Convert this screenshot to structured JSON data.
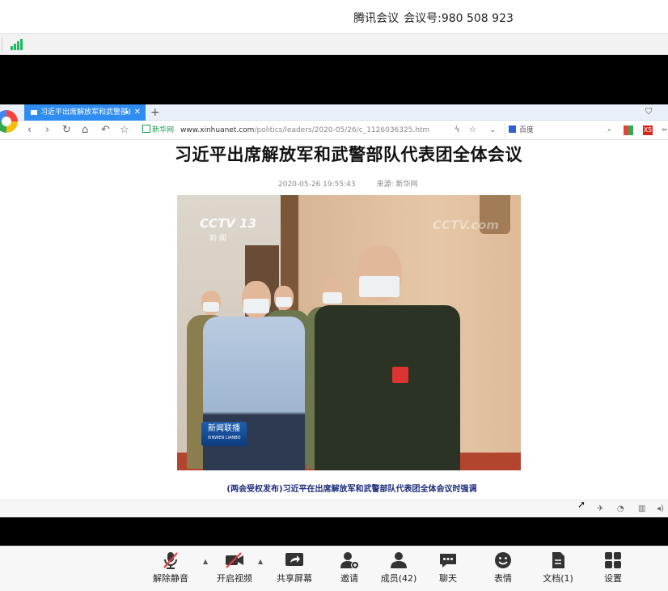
{
  "meeting": {
    "app_name": "腾讯会议",
    "id_label": "会议号:",
    "id_value": "980 508 923"
  },
  "browser": {
    "tab_title": "习近平出席解放军和武警部",
    "address": {
      "site_tag": "新华网",
      "host": "www.xinhuanet.com",
      "path": "/politics/leaders/2020-05/26/c_1126036325.htm"
    },
    "search_engine_label": "百度",
    "icons": [
      "back-icon",
      "forward-icon",
      "refresh-icon",
      "home-icon",
      "undo-icon",
      "star-icon",
      "lightning-icon",
      "bookmark-star-icon",
      "dropdown-icon",
      "search-icon",
      "shirt-icon"
    ]
  },
  "article": {
    "title": "习近平出席解放军和武警部队代表团全体会议",
    "date": "2020-05-26 19:55:43",
    "source_label": "来源:",
    "source_value": "新华网",
    "photo_overlay": {
      "channel_logo": "CCTV 13",
      "channel_sub": "新 闻",
      "watermark": "CCTV.com",
      "badge_main": "新闻联播",
      "badge_sub": "XINWEN LIANBO"
    },
    "caption": "(两会受权发布)习近平在出席解放军和武警部队代表团全体会议时强调"
  },
  "toolbar": {
    "buttons": [
      {
        "label": "解除静音",
        "icon": "microphone-muted-icon"
      },
      {
        "label": "开启视频",
        "icon": "camera-off-icon"
      },
      {
        "label": "共享屏幕",
        "icon": "share-screen-icon"
      },
      {
        "label": "邀请",
        "icon": "invite-user-icon"
      },
      {
        "label": "成员(42)",
        "icon": "members-icon"
      },
      {
        "label": "聊天",
        "icon": "chat-icon"
      },
      {
        "label": "表情",
        "icon": "emoji-icon"
      },
      {
        "label": "文档(1)",
        "icon": "document-icon"
      },
      {
        "label": "设置",
        "icon": "settings-grid-icon"
      }
    ]
  },
  "colors": {
    "signal": "#1dbb5f",
    "tab_active": "#2f8cf0",
    "caption": "#1a2b7a",
    "mute_red": "#e23d3d"
  }
}
